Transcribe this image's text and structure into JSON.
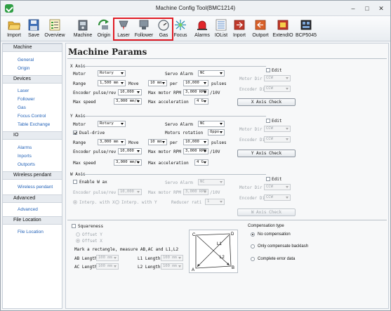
{
  "window": {
    "title": "Machine Config Tool(BMC1214)",
    "min": "–",
    "max": "□",
    "close": "✕"
  },
  "toolbar": [
    {
      "label": "Import",
      "icon": "folder-open-icon"
    },
    {
      "label": "Save",
      "icon": "floppy-disk-icon"
    },
    {
      "label": "Overview",
      "icon": "overview-list-icon"
    },
    {
      "label": "Machine",
      "icon": "machine-icon"
    },
    {
      "label": "Origin",
      "icon": "origin-arrow-icon"
    },
    {
      "label": "Laser",
      "icon": "laser-head-icon"
    },
    {
      "label": "Follower",
      "icon": "follower-icon"
    },
    {
      "label": "Gas",
      "icon": "gas-gauge-icon"
    },
    {
      "label": "Focus",
      "icon": "focus-icon"
    },
    {
      "label": "Alarms",
      "icon": "alarm-light-icon"
    },
    {
      "label": "IOList",
      "icon": "io-list-icon"
    },
    {
      "label": "Inport",
      "icon": "inport-icon"
    },
    {
      "label": "Outport",
      "icon": "outport-icon"
    },
    {
      "label": "ExtendIO",
      "icon": "extend-io-icon"
    },
    {
      "label": "BCP5045",
      "icon": "controller-board-icon"
    }
  ],
  "sidebar": [
    {
      "header": "Machine",
      "items": [
        "General",
        "Origin"
      ]
    },
    {
      "header": "Devices",
      "items": [
        "Laser",
        "Follower",
        "Gas",
        "Focus Control",
        "Table Exchange"
      ]
    },
    {
      "header": "IO",
      "items": [
        "Alarms",
        "Inports",
        "Outports"
      ]
    },
    {
      "header": "Wireless pendant",
      "items": [
        "Wireless pendant"
      ]
    },
    {
      "header": "Advanced",
      "items": [
        "Advanced"
      ]
    },
    {
      "header": "File Location",
      "items": [
        "File Location"
      ]
    }
  ],
  "page_title": "Machine Params",
  "x_axis": {
    "title": "X Axis",
    "motor_label": "Motor",
    "motor": "Rotary",
    "servo_alarm_label": "Servo Alarm",
    "servo_alarm": "NC",
    "edit_label": "Edit",
    "motor_dir_label": "Motor Dir",
    "motor_dir": "CCW",
    "encoder_dir_label": "Encoder Dir",
    "encoder_dir": "CCW",
    "range_label": "Range",
    "range": "1,500 mm",
    "move_label": "Move",
    "move": "10 mm",
    "per_label": "per",
    "per": "10,000",
    "pulses_label": "pulses",
    "enc_label": "Encoder pulse/rev",
    "enc": "10,000",
    "max_rpm_label": "Max motor RPM",
    "max_rpm": "3,000 RPM",
    "rpm_unit": "/10V",
    "speed_label": "Max speed",
    "speed": "3,000 mm/s",
    "accel_label": "Max acceleration",
    "accel": "4 G",
    "check": "X Axis Check"
  },
  "y_axis": {
    "title": "Y Axis",
    "motor_label": "Motor",
    "motor": "Rotary",
    "servo_alarm_label": "Servo Alarm",
    "servo_alarm": "NC",
    "edit_label": "Edit",
    "dual_label": "Dual-drive",
    "rotation_label": "Motors rotation",
    "rotation": "Oppo",
    "motor_dir_label": "Motor Dir",
    "motor_dir": "CCW",
    "encoder_dir_label": "Encoder Dir",
    "encoder_dir": "CCW",
    "range_label": "Range",
    "range": "3,000 mm",
    "move_label": "Move",
    "move": "10 mm",
    "per_label": "per",
    "per": "10,000",
    "pulses_label": "pulses",
    "enc_label": "Encoder pulse/rev",
    "enc": "10,000",
    "max_rpm_label": "Max motor RPM",
    "max_rpm": "3,000 RPM",
    "rpm_unit": "/10V",
    "speed_label": "Max speed",
    "speed": "3,000 mm/s",
    "accel_label": "Max acceleration",
    "accel": "4 G",
    "check": "Y Axis Check"
  },
  "w_axis": {
    "title": "W Axis",
    "enable_label": "Enable W ax",
    "servo_alarm_label": "Servo Alarm",
    "servo_alarm": "NC",
    "edit_label": "Edit",
    "motor_dir_label": "Motor Dir",
    "motor_dir": "CCW",
    "encoder_dir_label": "Encoder Dir",
    "encoder_dir": "CCW",
    "enc_label": "Encoder pulse/rev",
    "enc": "10,000",
    "max_rpm_label": "Max motor RPM",
    "max_rpm": "3,000 RPM",
    "rpm_unit": "/10V",
    "interp_x": "Interp. with X",
    "interp_y": "Interp. with Y",
    "reducer_label": "Reducer rati",
    "reducer": "1",
    "check": "W Axis Check"
  },
  "squareness": {
    "title": "Squareness",
    "offset_y": "Offset Y",
    "offset_x": "Offset X",
    "instruction": "Mark a rectangle, measure AB,AC and L1,L2",
    "ab_label": "AB Length",
    "ab": "100 mm",
    "l1_label": "L1 Length",
    "l1": "100 mm",
    "ac_label": "AC Length",
    "ac": "100 mm",
    "l2_label": "L2 Length",
    "l2": "100 mm",
    "diagram": {
      "a": "A",
      "b": "B",
      "c": "C",
      "d": "D",
      "l1": "L1",
      "l2": "L2"
    }
  },
  "compensation": {
    "title": "Compensation type",
    "options": [
      "No compensation",
      "Only compensate backlash",
      "Complete error data"
    ],
    "selected": 0
  },
  "colors": {
    "highlight": "#e01b24",
    "link": "#2463b8"
  }
}
